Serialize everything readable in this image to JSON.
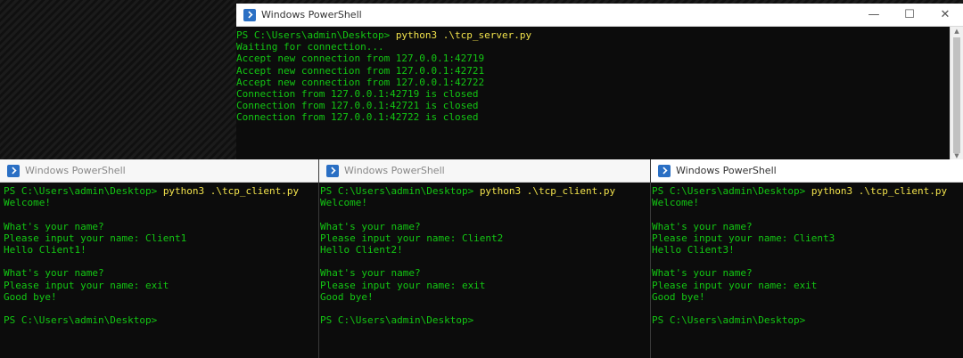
{
  "server_window": {
    "title": "Windows PowerShell",
    "controls": {
      "minimize": "—",
      "maximize": "☐",
      "close": "✕"
    },
    "lines": [
      {
        "text": "PS C:\\Users\\admin\\Desktop> ",
        "cmd": "python3 .\\tcp_server.py"
      },
      {
        "text": "Waiting for connection..."
      },
      {
        "text": "Accept new connection from 127.0.0.1:42719"
      },
      {
        "text": "Accept new connection from 127.0.0.1:42721"
      },
      {
        "text": "Accept new connection from 127.0.0.1:42722"
      },
      {
        "text": "Connection from 127.0.0.1:42719 is closed"
      },
      {
        "text": "Connection from 127.0.0.1:42721 is closed"
      },
      {
        "text": "Connection from 127.0.0.1:42722 is closed"
      }
    ]
  },
  "client_windows": [
    {
      "title": "Windows PowerShell",
      "lines": [
        {
          "text": "PS C:\\Users\\admin\\Desktop> ",
          "cmd": "python3 .\\tcp_client.py"
        },
        {
          "text": "Welcome!"
        },
        {
          "text": ""
        },
        {
          "text": "What's your name?"
        },
        {
          "text": "Please input your name: Client1"
        },
        {
          "text": "Hello Client1!"
        },
        {
          "text": ""
        },
        {
          "text": "What's your name?"
        },
        {
          "text": "Please input your name: exit"
        },
        {
          "text": "Good bye!"
        },
        {
          "text": ""
        },
        {
          "text": "PS C:\\Users\\admin\\Desktop>"
        }
      ]
    },
    {
      "title": "Windows PowerShell",
      "lines": [
        {
          "text": "PS C:\\Users\\admin\\Desktop> ",
          "cmd": "python3 .\\tcp_client.py"
        },
        {
          "text": "Welcome!"
        },
        {
          "text": ""
        },
        {
          "text": "What's your name?"
        },
        {
          "text": "Please input your name: Client2"
        },
        {
          "text": "Hello Client2!"
        },
        {
          "text": ""
        },
        {
          "text": "What's your name?"
        },
        {
          "text": "Please input your name: exit"
        },
        {
          "text": "Good bye!"
        },
        {
          "text": ""
        },
        {
          "text": "PS C:\\Users\\admin\\Desktop>"
        }
      ]
    },
    {
      "title": "Windows PowerShell",
      "lines": [
        {
          "text": "PS C:\\Users\\admin\\Desktop> ",
          "cmd": "python3 .\\tcp_client.py"
        },
        {
          "text": "Welcome!"
        },
        {
          "text": ""
        },
        {
          "text": "What's your name?"
        },
        {
          "text": "Please input your name: Client3"
        },
        {
          "text": "Hello Client3!"
        },
        {
          "text": ""
        },
        {
          "text": "What's your name?"
        },
        {
          "text": "Please input your name: exit"
        },
        {
          "text": "Good bye!"
        },
        {
          "text": ""
        },
        {
          "text": "PS C:\\Users\\admin\\Desktop>"
        }
      ]
    }
  ],
  "colors": {
    "output": "#13c713",
    "command": "#f2e34c",
    "console_bg": "#0c0c0c"
  }
}
